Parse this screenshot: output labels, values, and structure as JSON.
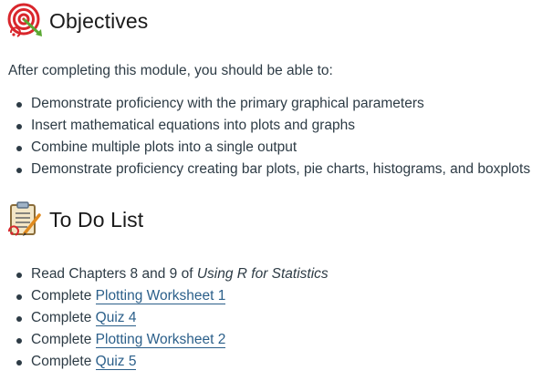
{
  "objectives": {
    "title": "Objectives",
    "icon": "target-icon",
    "intro": "After completing this module, you should be able to:",
    "items": [
      "Demonstrate proficiency with the primary graphical parameters",
      "Insert mathematical equations into plots and graphs",
      "Combine multiple plots into a single output",
      "Demonstrate proficiency creating bar plots, pie charts, histograms, and boxplots"
    ]
  },
  "todo": {
    "title": "To Do List",
    "icon": "checklist-icon",
    "items": [
      {
        "prefix": "Read Chapters 8 and 9 of ",
        "book": "Using R for Statistics"
      },
      {
        "prefix": "Complete ",
        "link": "Plotting Worksheet 1"
      },
      {
        "prefix": "Complete ",
        "link": "Quiz 4"
      },
      {
        "prefix": "Complete ",
        "link": "Plotting Worksheet 2"
      },
      {
        "prefix": "Complete ",
        "link": "Quiz 5"
      }
    ]
  },
  "colors": {
    "text": "#2d3b45",
    "link": "#2b5f8a",
    "icon_red": "#d9262c",
    "icon_green": "#5aa832"
  }
}
